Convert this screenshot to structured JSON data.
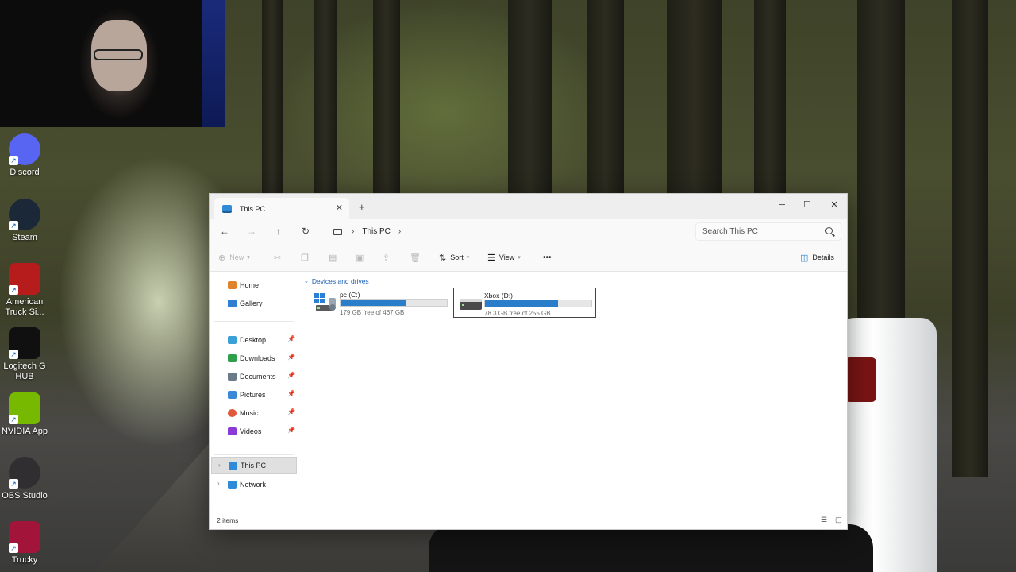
{
  "desktop": {
    "icons": [
      {
        "label": "Discord",
        "color": "#5865f2",
        "icon": "discord-icon"
      },
      {
        "label": "Steam",
        "color": "#1b2838",
        "icon": "steam-icon"
      },
      {
        "label": "American Truck Si...",
        "color": "#b71c1c",
        "icon": "truck-icon"
      },
      {
        "label": "Logitech G HUB",
        "color": "#101010",
        "icon": "logitech-g-icon"
      },
      {
        "label": "NVIDIA App",
        "color": "#76b900",
        "icon": "nvidia-icon"
      },
      {
        "label": "OBS Studio",
        "color": "#302e31",
        "icon": "obs-icon"
      },
      {
        "label": "Trucky",
        "color": "#a3143a",
        "icon": "trucky-icon"
      }
    ]
  },
  "window": {
    "tab_title": "This PC",
    "new_tab": "+",
    "controls": {
      "minimize": "─",
      "maximize": "☐",
      "close": "✕"
    },
    "breadcrumb": [
      "This PC"
    ],
    "search_placeholder": "Search This PC",
    "toolbar": {
      "new_label": "New",
      "sort_label": "Sort",
      "view_label": "View",
      "more_label": "•••",
      "details_label": "Details"
    },
    "sidebar": {
      "top": [
        {
          "label": "Home",
          "icon": "home-icon",
          "color": "#e0842b"
        },
        {
          "label": "Gallery",
          "icon": "gallery-icon",
          "color": "#2f7fd2"
        }
      ],
      "pinned": [
        {
          "label": "Desktop",
          "icon": "desktop-folder-icon",
          "color": "#3aa0d8"
        },
        {
          "label": "Downloads",
          "icon": "downloads-icon",
          "color": "#2fa04a"
        },
        {
          "label": "Documents",
          "icon": "documents-icon",
          "color": "#6b7a8a"
        },
        {
          "label": "Pictures",
          "icon": "pictures-icon",
          "color": "#3a88d6"
        },
        {
          "label": "Music",
          "icon": "music-icon",
          "color": "#e0573a"
        },
        {
          "label": "Videos",
          "icon": "videos-icon",
          "color": "#8a3ad6"
        }
      ],
      "bottom": [
        {
          "label": "This PC",
          "icon": "this-pc-icon",
          "color": "#2f8ad8"
        },
        {
          "label": "Network",
          "icon": "network-icon",
          "color": "#2f8ad8"
        }
      ]
    },
    "content": {
      "group_label": "Devices and drives",
      "drives": [
        {
          "name": "pc (C:)",
          "free_text": "179 GB free of 467 GB",
          "used_fraction": 0.62
        },
        {
          "name": "Xbox (D:)",
          "free_text": "78.3 GB free of 255 GB",
          "used_fraction": 0.69
        }
      ]
    },
    "status": "2 items"
  }
}
